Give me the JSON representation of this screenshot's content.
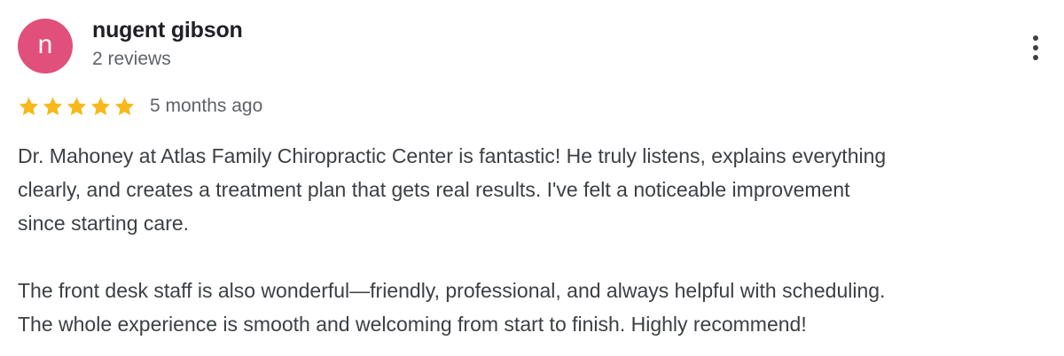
{
  "review": {
    "avatar": {
      "initial": "n",
      "color": "#E0507A",
      "icon": "avatar-letter"
    },
    "reviewer_name": "nugent gibson",
    "review_count": "2 reviews",
    "more_options_icon": "more-vert-icon",
    "rating": {
      "stars": 5,
      "max_stars": 5,
      "star_color": "#F6B81A",
      "icon": "star-icon"
    },
    "time_ago": "5 months ago",
    "paragraphs": [
      "Dr. Mahoney at Atlas Family Chiropractic Center is fantastic! He truly listens, explains everything\nclearly, and creates a treatment plan that gets real results. I've felt a noticeable improvement\nsince starting care.",
      "The front desk staff is also wonderful—friendly, professional, and always helpful with scheduling.\nThe whole experience is smooth and welcoming from start to finish. Highly recommend!"
    ]
  }
}
